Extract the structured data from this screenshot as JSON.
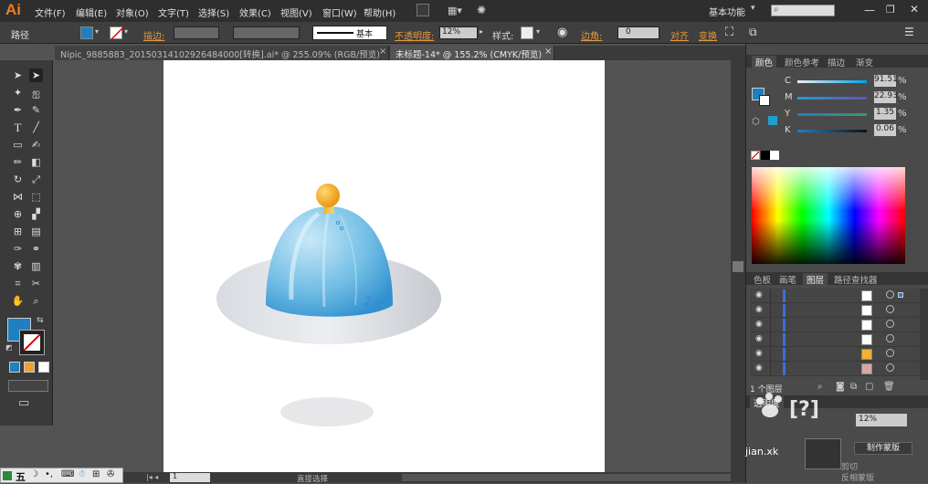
{
  "app": {
    "logo": "Ai",
    "workspace_label": "基本功能",
    "search_placeholder": "",
    "bridge_label": "Br"
  },
  "menu": [
    "文件(F)",
    "编辑(E)",
    "对象(O)",
    "文字(T)",
    "选择(S)",
    "效果(C)",
    "视图(V)",
    "窗口(W)",
    "帮助(H)"
  ],
  "control_bar": {
    "selection_label": "路径",
    "fill_color": "#1f7fc1",
    "stroke_label": "描边:",
    "stroke_profile": "基本",
    "opacity_label": "不透明度:",
    "opacity_value": "12%",
    "style_label": "样式:",
    "corner_label": "边角:",
    "corner_value": "0",
    "align_label": "对齐",
    "transform_label": "变换"
  },
  "tabs": [
    {
      "label": "Nipic_9885883_20150314102926484000[转换].ai* @ 255.09% (RGB/预览)",
      "active": false
    },
    {
      "label": "未标题-14* @ 155.2% (CMYK/预览)",
      "active": true
    }
  ],
  "color_panel": {
    "tabs": [
      "颜色",
      "颜色参考",
      "描边",
      "渐变"
    ],
    "channels": [
      {
        "label": "C",
        "value": "91.51",
        "unit": "%"
      },
      {
        "label": "M",
        "value": "22.93",
        "unit": "%"
      },
      {
        "label": "Y",
        "value": "1.35",
        "unit": "%"
      },
      {
        "label": "K",
        "value": "0.06",
        "unit": "%"
      }
    ]
  },
  "layers_panel": {
    "tabs": [
      "色板",
      "画笔",
      "图层",
      "路径查找器"
    ],
    "status": "1 个图层",
    "swatch_colors": [
      "#ffffff",
      "#ffffff",
      "#ffffff",
      "#ffffff",
      "#f0b030",
      "#d8a8a8"
    ]
  },
  "transparency_panel": {
    "tab": "透明度",
    "value": "12%",
    "make_mask": "制作蒙版",
    "invert_mask": "反相蒙版",
    "clip_label": "剪切"
  },
  "status_bar": {
    "zoom": "1",
    "tool": "直接选择"
  },
  "watermark": "jian.xk",
  "taskbar": {
    "ime": "五"
  }
}
